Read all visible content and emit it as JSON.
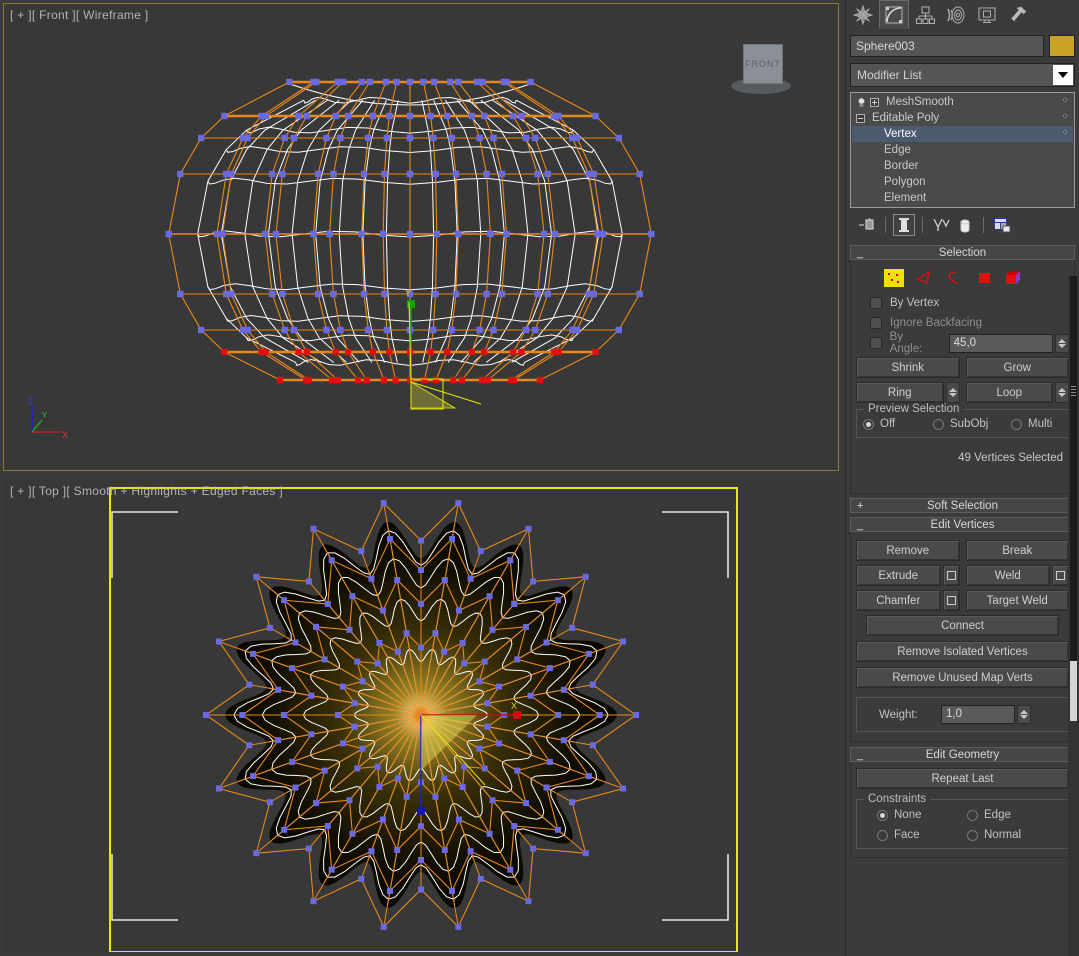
{
  "viewports": [
    {
      "label": "[ + ][ Front ][ Wireframe ]",
      "name": "front-wireframe",
      "active": false,
      "viewcube_label": "FRONT"
    },
    {
      "label": "[ + ][ Top ][ Smooth + Highlights + Edged Faces ]",
      "name": "top-shaded",
      "active": true
    }
  ],
  "axis_tripod": {
    "x": "X",
    "y": "Y",
    "z": "Z"
  },
  "command_panel": {
    "tabs": [
      {
        "name": "create-tab",
        "icon": "star-icon",
        "active": false
      },
      {
        "name": "modify-tab",
        "icon": "arc-curve-icon",
        "active": true
      },
      {
        "name": "hierarchy-tab",
        "icon": "hierarchy-tree-icon",
        "active": false
      },
      {
        "name": "motion-tab",
        "icon": "motion-rings-icon",
        "active": false
      },
      {
        "name": "display-tab",
        "icon": "display-monitor-icon",
        "active": false
      },
      {
        "name": "utilities-tab",
        "icon": "hammer-icon",
        "active": false
      }
    ],
    "object_name": "Sphere003",
    "object_color": "#c9a227",
    "modifier_list_label": "Modifier List",
    "stack": [
      {
        "label": "MeshSmooth",
        "toggle": "plus",
        "selected": false,
        "child": false
      },
      {
        "label": "Editable Poly",
        "toggle": "minus",
        "selected": false,
        "child": false
      },
      {
        "label": "Vertex",
        "selected": true,
        "child": true
      },
      {
        "label": "Edge",
        "selected": false,
        "child": true
      },
      {
        "label": "Border",
        "selected": false,
        "child": true
      },
      {
        "label": "Polygon",
        "selected": false,
        "child": true
      },
      {
        "label": "Element",
        "selected": false,
        "child": true
      }
    ],
    "stack_tools": [
      {
        "name": "pin-stack-icon",
        "active": false
      },
      {
        "name": "show-end-result-icon",
        "active": true
      },
      {
        "name": "make-unique-icon",
        "active": false
      },
      {
        "name": "remove-modifier-icon",
        "active": false
      },
      {
        "name": "configure-modifier-sets-icon",
        "active": false
      }
    ]
  },
  "selection_rollout": {
    "title": "Selection",
    "expanded": true,
    "subobject_modes": [
      {
        "name": "vertex-mode-icon",
        "active": true
      },
      {
        "name": "edge-mode-icon",
        "active": false
      },
      {
        "name": "border-mode-icon",
        "active": false
      },
      {
        "name": "polygon-mode-icon",
        "active": false
      },
      {
        "name": "element-mode-icon",
        "active": false
      }
    ],
    "by_vertex_label": "By Vertex",
    "by_vertex_checked": false,
    "ignore_backfacing_label": "Ignore Backfacing",
    "ignore_backfacing_checked": false,
    "by_angle_label": "By Angle:",
    "by_angle_checked": false,
    "by_angle_value": "45,0",
    "shrink_label": "Shrink",
    "grow_label": "Grow",
    "ring_label": "Ring",
    "loop_label": "Loop",
    "preview_selection": {
      "title": "Preview Selection",
      "options": [
        {
          "label": "Off",
          "selected": true
        },
        {
          "label": "SubObj",
          "selected": false
        },
        {
          "label": "Multi",
          "selected": false
        }
      ]
    },
    "status": "49 Vertices Selected"
  },
  "soft_selection_rollout": {
    "title": "Soft Selection",
    "expanded": false
  },
  "edit_vertices_rollout": {
    "title": "Edit Vertices",
    "expanded": true,
    "remove_label": "Remove",
    "break_label": "Break",
    "extrude_label": "Extrude",
    "weld_label": "Weld",
    "chamfer_label": "Chamfer",
    "target_weld_label": "Target Weld",
    "connect_label": "Connect",
    "remove_isolated_label": "Remove Isolated Vertices",
    "remove_unused_label": "Remove Unused Map Verts",
    "weight_label": "Weight:",
    "weight_value": "1,0"
  },
  "edit_geometry_rollout": {
    "title": "Edit Geometry",
    "expanded": true,
    "repeat_last_label": "Repeat Last",
    "constraints": {
      "title": "Constraints",
      "options": [
        {
          "label": "None",
          "selected": true
        },
        {
          "label": "Edge",
          "selected": false
        },
        {
          "label": "Face",
          "selected": false
        },
        {
          "label": "Normal",
          "selected": false
        }
      ]
    }
  },
  "colors": {
    "cage": "#e8881a",
    "mesh": "#ffffff",
    "vertex": "#6a6ae0",
    "vertex_selected": "#e01010",
    "active_viewport_border": "#e8e800",
    "highlight": "#4c5a70"
  }
}
